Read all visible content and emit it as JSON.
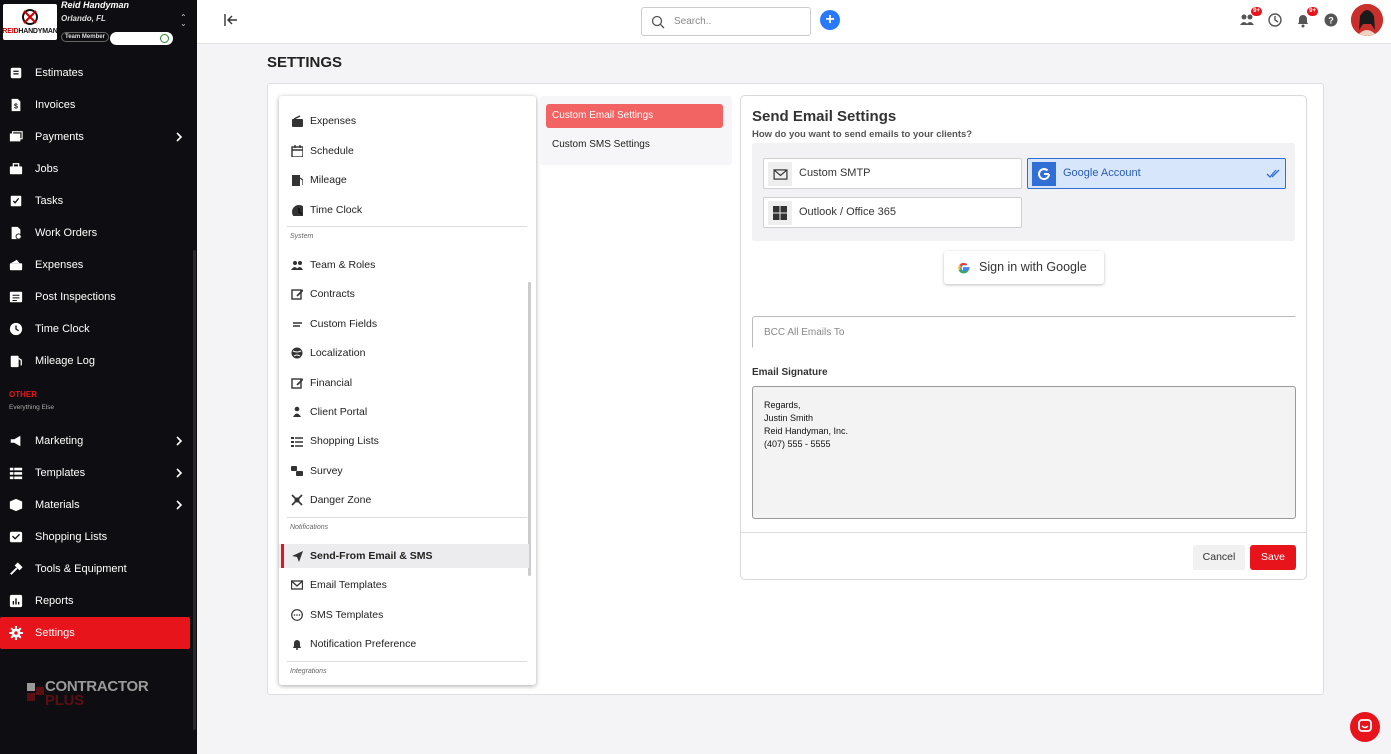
{
  "brand": {
    "name": "Reid Handyman",
    "location": "Orlando, FL",
    "role": "Team Member",
    "logo_text": "REIDHANDYMAN"
  },
  "sidebar": {
    "items": [
      {
        "label": "Estimates",
        "icon": "estimates-icon"
      },
      {
        "label": "Invoices",
        "icon": "invoice-icon"
      },
      {
        "label": "Payments",
        "icon": "payments-icon",
        "chevron": true
      },
      {
        "label": "Jobs",
        "icon": "jobs-icon"
      },
      {
        "label": "Tasks",
        "icon": "tasks-icon"
      },
      {
        "label": "Work Orders",
        "icon": "work-orders-icon"
      },
      {
        "label": "Expenses",
        "icon": "expenses-icon"
      },
      {
        "label": "Post Inspections",
        "icon": "post-inspections-icon"
      },
      {
        "label": "Time Clock",
        "icon": "clock-icon"
      },
      {
        "label": "Mileage Log",
        "icon": "mileage-icon"
      }
    ],
    "other_title": "OTHER",
    "other_subtitle": "Everything Else",
    "other_items": [
      {
        "label": "Marketing",
        "icon": "marketing-icon",
        "chevron": true
      },
      {
        "label": "Templates",
        "icon": "templates-icon",
        "chevron": true
      },
      {
        "label": "Materials",
        "icon": "materials-icon",
        "chevron": true
      },
      {
        "label": "Shopping Lists",
        "icon": "shopping-list-icon"
      },
      {
        "label": "Tools & Equipment",
        "icon": "tools-icon"
      },
      {
        "label": "Reports",
        "icon": "reports-icon"
      },
      {
        "label": "Settings",
        "icon": "gear-icon",
        "active": true
      }
    ],
    "footer_logo_line1": "CONTRACTOR",
    "footer_logo_line2": "PLUS"
  },
  "topbar": {
    "search_placeholder": "Search..",
    "badge_1": "9+",
    "badge_2": "9+"
  },
  "page": {
    "title": "SETTINGS"
  },
  "settings_menu": {
    "items_top": [
      {
        "label": "Expenses",
        "icon": "wallet-icon"
      },
      {
        "label": "Schedule",
        "icon": "calendar-icon"
      },
      {
        "label": "Mileage",
        "icon": "fuel-icon"
      },
      {
        "label": "Time Clock",
        "icon": "clock-icon"
      }
    ],
    "system_header": "System",
    "system_items": [
      {
        "label": "Team & Roles",
        "icon": "team-icon"
      },
      {
        "label": "Contracts",
        "icon": "contract-icon"
      },
      {
        "label": "Custom Fields",
        "icon": "fields-icon"
      },
      {
        "label": "Localization",
        "icon": "globe-icon"
      },
      {
        "label": "Financial",
        "icon": "financial-icon"
      },
      {
        "label": "Client Portal",
        "icon": "person-icon"
      },
      {
        "label": "Shopping Lists",
        "icon": "list-icon"
      },
      {
        "label": "Survey",
        "icon": "survey-icon"
      },
      {
        "label": "Danger Zone",
        "icon": "danger-icon"
      }
    ],
    "notifications_header": "Notifications",
    "notification_items": [
      {
        "label": "Send-From Email & SMS",
        "icon": "send-icon",
        "selected": true
      },
      {
        "label": "Email Templates",
        "icon": "mail-icon"
      },
      {
        "label": "SMS Templates",
        "icon": "chat-bubble-icon"
      },
      {
        "label": "Notification Preference",
        "icon": "bell-icon"
      }
    ],
    "integrations_header": "Integrations"
  },
  "submenu": {
    "items": [
      {
        "label": "Custom Email Settings",
        "active": true
      },
      {
        "label": "Custom SMS Settings"
      }
    ]
  },
  "email_settings": {
    "title": "Send Email Settings",
    "subtitle": "How do you want to send emails to your clients?",
    "options": [
      {
        "label": "Custom SMTP",
        "icon": "mail-icon"
      },
      {
        "label": "Google Account",
        "icon": "google-icon",
        "selected": true
      },
      {
        "label": "Outlook / Office 365",
        "icon": "windows-icon"
      }
    ],
    "google_button": "Sign in with Google",
    "bcc_placeholder": "BCC All Emails To",
    "signature_label": "Email Signature",
    "signature_lines": [
      "Regards,",
      "Justin Smith",
      "Reid Handyman, Inc.",
      "(407) 555 - 5555"
    ],
    "cancel_label": "Cancel",
    "save_label": "Save"
  },
  "colors": {
    "accent": "#e8141c",
    "sidebar_bg": "#0e0e12",
    "primary_blue": "#2979ff",
    "selected_option": "#d8e6fc",
    "submenu_active": "#f26363"
  }
}
